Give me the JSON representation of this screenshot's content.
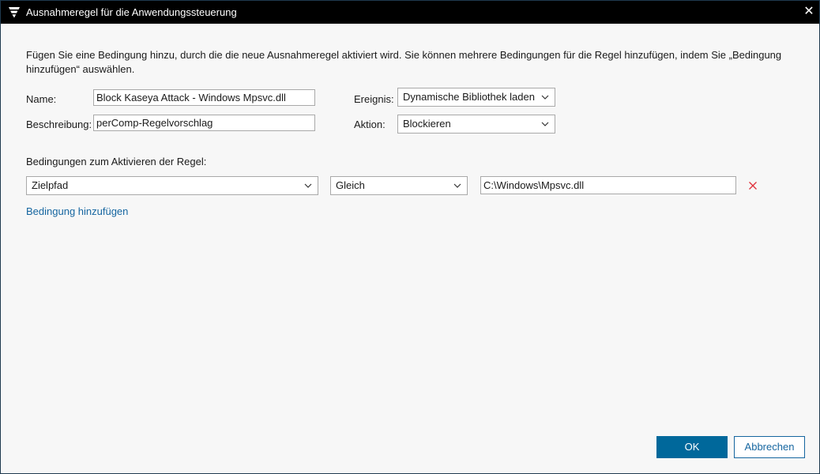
{
  "window": {
    "title": "Ausnahmeregel für die Anwendungssteuerung",
    "close_glyph": "✕"
  },
  "intro": "Fügen Sie eine Bedingung hinzu, durch die die neue Ausnahmeregel aktiviert wird. Sie können mehrere Bedingungen für die Regel hinzufügen, indem Sie „Bedingung hinzufügen“ auswählen.",
  "form": {
    "name_label": "Name:",
    "name_value": "Block Kaseya Attack - Windows Mpsvc.dll",
    "description_label": "Beschreibung:",
    "description_value": "perComp-Regelvorschlag",
    "event_label": "Ereignis:",
    "event_value": "Dynamische Bibliothek laden",
    "action_label": "Aktion:",
    "action_value": "Blockieren"
  },
  "conditions": {
    "heading": "Bedingungen zum Aktivieren der Regel:",
    "rows": [
      {
        "field": "Zielpfad",
        "operator": "Gleich",
        "value": "C:\\Windows\\Mpsvc.dll"
      }
    ],
    "add_link": "Bedingung hinzufügen"
  },
  "buttons": {
    "ok": "OK",
    "cancel": "Abbrechen"
  },
  "colors": {
    "accent": "#00689b",
    "link": "#1666a0",
    "remove": "#e0303a"
  }
}
